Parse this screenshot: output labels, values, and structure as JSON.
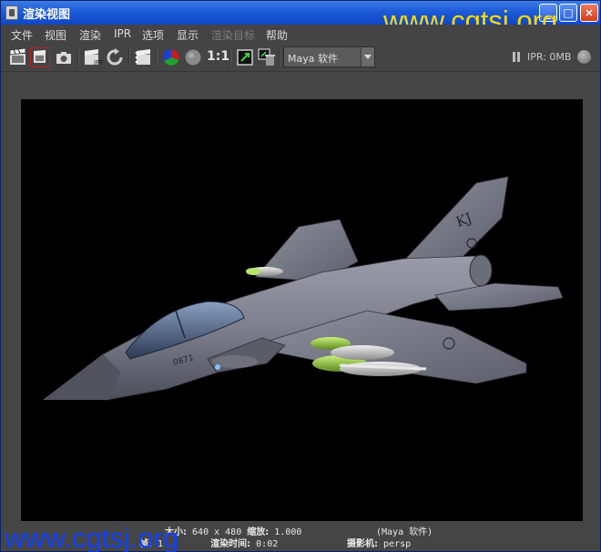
{
  "window": {
    "title": "渲染视图",
    "watermark": "www.cgtsj.org"
  },
  "menu": [
    "文件",
    "视图",
    "渲染",
    "IPR",
    "选项",
    "显示",
    "渲染目标",
    "帮助"
  ],
  "toolbar": {
    "ratio_label": "1:1",
    "renderer_select": "Maya 软件",
    "ipr_status": "IPR: 0MB"
  },
  "render": {
    "tail_code": "KJ",
    "nose_number": "0871"
  },
  "status": {
    "size_label": "大小:",
    "size_value": "640 x 480",
    "zoom_label": "缩放:",
    "zoom_value": "1.000",
    "renderer": "(Maya 软件)",
    "frame_label": "帧:",
    "frame_value": "1",
    "time_label": "渲染时间:",
    "time_value": "0:02",
    "camera_label": "摄影机:",
    "camera_value": "persp"
  },
  "colors": {
    "title_bar": "#1c5ad6",
    "watermark_top": "#ffd800",
    "watermark_bottom": "#1040ff",
    "panel": "#444444"
  }
}
